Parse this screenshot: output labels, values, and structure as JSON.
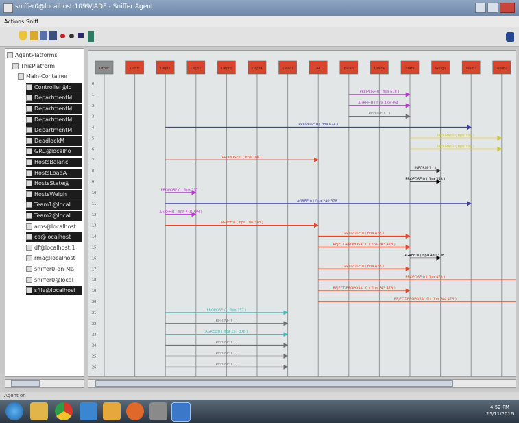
{
  "window": {
    "title": "sniffer0@localhost:1099/JADE - Sniffer Agent"
  },
  "menu": {
    "items": [
      "Actions",
      "Sniff"
    ]
  },
  "toolbar": {
    "icons": [
      "clear-icon",
      "open-icon",
      "save-icon",
      "save-as-icon",
      "record-icon",
      "stop-icon",
      "message-filter-icon",
      "exit-icon"
    ]
  },
  "tree": {
    "nodes": [
      {
        "label": "AgentPlatforms",
        "level": 0,
        "style": "light"
      },
      {
        "label": "ThisPlatform",
        "level": 1,
        "style": "light"
      },
      {
        "label": "Main-Container",
        "level": 2,
        "style": "light"
      },
      {
        "label": "Controller@lo",
        "level": 3,
        "style": "dark"
      },
      {
        "label": "DepartmentM",
        "level": 3,
        "style": "dark"
      },
      {
        "label": "DepartmentM",
        "level": 3,
        "style": "dark"
      },
      {
        "label": "DepartmentM",
        "level": 3,
        "style": "dark"
      },
      {
        "label": "DepartmentM",
        "level": 3,
        "style": "dark"
      },
      {
        "label": "DeadlockM",
        "level": 3,
        "style": "dark"
      },
      {
        "label": "GRC@localho",
        "level": 3,
        "style": "dark"
      },
      {
        "label": "HostsBalanc",
        "level": 3,
        "style": "dark"
      },
      {
        "label": "HostsLoadA",
        "level": 3,
        "style": "dark"
      },
      {
        "label": "HostsState@",
        "level": 3,
        "style": "dark"
      },
      {
        "label": "HostsWeigh",
        "level": 3,
        "style": "dark"
      },
      {
        "label": "Team1@local",
        "level": 3,
        "style": "dark"
      },
      {
        "label": "Team2@local",
        "level": 3,
        "style": "dark"
      },
      {
        "label": "ams@localhost",
        "level": 3,
        "style": "light"
      },
      {
        "label": "ca@localhost",
        "level": 3,
        "style": "dark"
      },
      {
        "label": "df@localhost:1",
        "level": 3,
        "style": "light"
      },
      {
        "label": "rma@localhost",
        "level": 3,
        "style": "light"
      },
      {
        "label": "sniffer0-on-Ma",
        "level": 3,
        "style": "light"
      },
      {
        "label": "sniffer0@local",
        "level": 3,
        "style": "light"
      },
      {
        "label": "sfile@localhost",
        "level": 3,
        "style": "dark"
      }
    ]
  },
  "agents": [
    {
      "label": "Other",
      "color": "#8a8d8e"
    },
    {
      "label": "Contr",
      "color": "#d9442f"
    },
    {
      "label": "Dept1",
      "color": "#d9442f"
    },
    {
      "label": "Dept2",
      "color": "#d9442f"
    },
    {
      "label": "Dept3",
      "color": "#d9442f"
    },
    {
      "label": "Dept4",
      "color": "#d9442f"
    },
    {
      "label": "Deadl",
      "color": "#d9442f"
    },
    {
      "label": "GRC",
      "color": "#d9442f"
    },
    {
      "label": "Balan",
      "color": "#d9442f"
    },
    {
      "label": "LoadA",
      "color": "#d9442f"
    },
    {
      "label": "State",
      "color": "#d9442f"
    },
    {
      "label": "Weigh",
      "color": "#d9442f"
    },
    {
      "label": "Team1",
      "color": "#d9442f"
    },
    {
      "label": "Team2",
      "color": "#d9442f"
    }
  ],
  "rows": [
    "0",
    "1",
    "2",
    "3",
    "4",
    "5",
    "6",
    "7",
    "8",
    "9",
    "10",
    "11",
    "12",
    "13",
    "14",
    "15",
    "16",
    "17",
    "18",
    "19",
    "20",
    "21",
    "22",
    "23",
    "24",
    "25",
    "26"
  ],
  "messages": [
    {
      "from": 8,
      "to": 10,
      "row": 1,
      "label": "PROPOSE:0 ( fipa 678 )",
      "color": "#b03cc8"
    },
    {
      "from": 8,
      "to": 10,
      "row": 2,
      "label": "AGREE:0 ( fipa 389 354 )",
      "color": "#b03cc8"
    },
    {
      "from": 8,
      "to": 10,
      "row": 3,
      "label": "REFUSE:1 ( )",
      "color": "#707070"
    },
    {
      "from": 2,
      "to": 12,
      "row": 4,
      "label": "PROPOSE:0 ( fipa 674 )",
      "color": "#3e3e9e"
    },
    {
      "from": 10,
      "to": 13,
      "row": 5,
      "label": "INFORM:0 ( fipa 236 )",
      "color": "#c6c63a"
    },
    {
      "from": 10,
      "to": 13,
      "row": 6,
      "label": "INFORM:1 ( fipa 236 )",
      "color": "#c6c63a"
    },
    {
      "from": 2,
      "to": 7,
      "row": 7,
      "label": "PROPOSE:0 ( fipa 188 )",
      "color": "#e04a2a"
    },
    {
      "from": 10,
      "to": 11,
      "row": 8,
      "label": "INFORM:1 ( )",
      "color": "#303030"
    },
    {
      "from": 10,
      "to": 11,
      "row": 9,
      "label": "PROPOSE:0 ( fipa 358 )",
      "color": "#000000"
    },
    {
      "from": 2,
      "to": 3,
      "row": 10,
      "label": "PROPOSE:0 ( fipa 237 )",
      "color": "#b03cc8"
    },
    {
      "from": 2,
      "to": 12,
      "row": 11,
      "label": "AGREE:0 ( fipa 240 378 )",
      "color": "#3e3e9e"
    },
    {
      "from": 2,
      "to": 3,
      "row": 12,
      "label": "AGREE:0 ( fipa 238 289 )",
      "color": "#b03cc8"
    },
    {
      "from": 2,
      "to": 7,
      "row": 13,
      "label": "AGREE:0 ( fipa 188 378 )",
      "color": "#e04a2a"
    },
    {
      "from": 7,
      "to": 10,
      "row": 14,
      "label": "PROPOSE:0 ( fipa 478 )",
      "color": "#e04a2a"
    },
    {
      "from": 7,
      "to": 10,
      "row": 15,
      "label": "REJECT-PROPOSAL:0 ( fipa 243 478 )",
      "color": "#e04a2a"
    },
    {
      "from": 10,
      "to": 11,
      "row": 16,
      "label": "AGREE:0 ( fipa 480 378 )",
      "color": "#000000"
    },
    {
      "from": 7,
      "to": 10,
      "row": 17,
      "label": "PROPOSE:0 ( fipa 478 )",
      "color": "#e04a2a"
    },
    {
      "from": 7,
      "to": 14,
      "row": 18,
      "label": "PROPOSE:0 ( fipa 478 )",
      "color": "#e04a2a"
    },
    {
      "from": 7,
      "to": 10,
      "row": 19,
      "label": "REJECT-PROPOSAL:0 ( fipa 243 478 )",
      "color": "#e04a2a"
    },
    {
      "from": 7,
      "to": 14,
      "row": 20,
      "label": "REJECT-PROPOSAL:0 ( fipa 244 478 )",
      "color": "#e04a2a"
    },
    {
      "from": 2,
      "to": 6,
      "row": 21,
      "label": "PROPOSE:0 ( fipa 157 )",
      "color": "#3ec0c0"
    },
    {
      "from": 2,
      "to": 6,
      "row": 22,
      "label": "REFUSE:1 ( )",
      "color": "#707070"
    },
    {
      "from": 2,
      "to": 6,
      "row": 23,
      "label": "AGREE:0 ( fipa 157 378 )",
      "color": "#3ec0c0"
    },
    {
      "from": 2,
      "to": 6,
      "row": 24,
      "label": "REFUSE:1 ( )",
      "color": "#707070"
    },
    {
      "from": 2,
      "to": 6,
      "row": 25,
      "label": "REFUSE:1 ( )",
      "color": "#707070"
    },
    {
      "from": 2,
      "to": 6,
      "row": 26,
      "label": "REFUSE:1 ( )",
      "color": "#707070"
    }
  ],
  "status": {
    "text": "Agent on"
  },
  "taskbar": {
    "apps": [
      "start-orb-icon",
      "file-explorer-icon",
      "chrome-icon",
      "ie-icon",
      "media-player-icon",
      "firefox-icon",
      "settings-icon",
      "java-app-icon"
    ],
    "time": "4:52 PM",
    "date": "26/11/2016"
  }
}
